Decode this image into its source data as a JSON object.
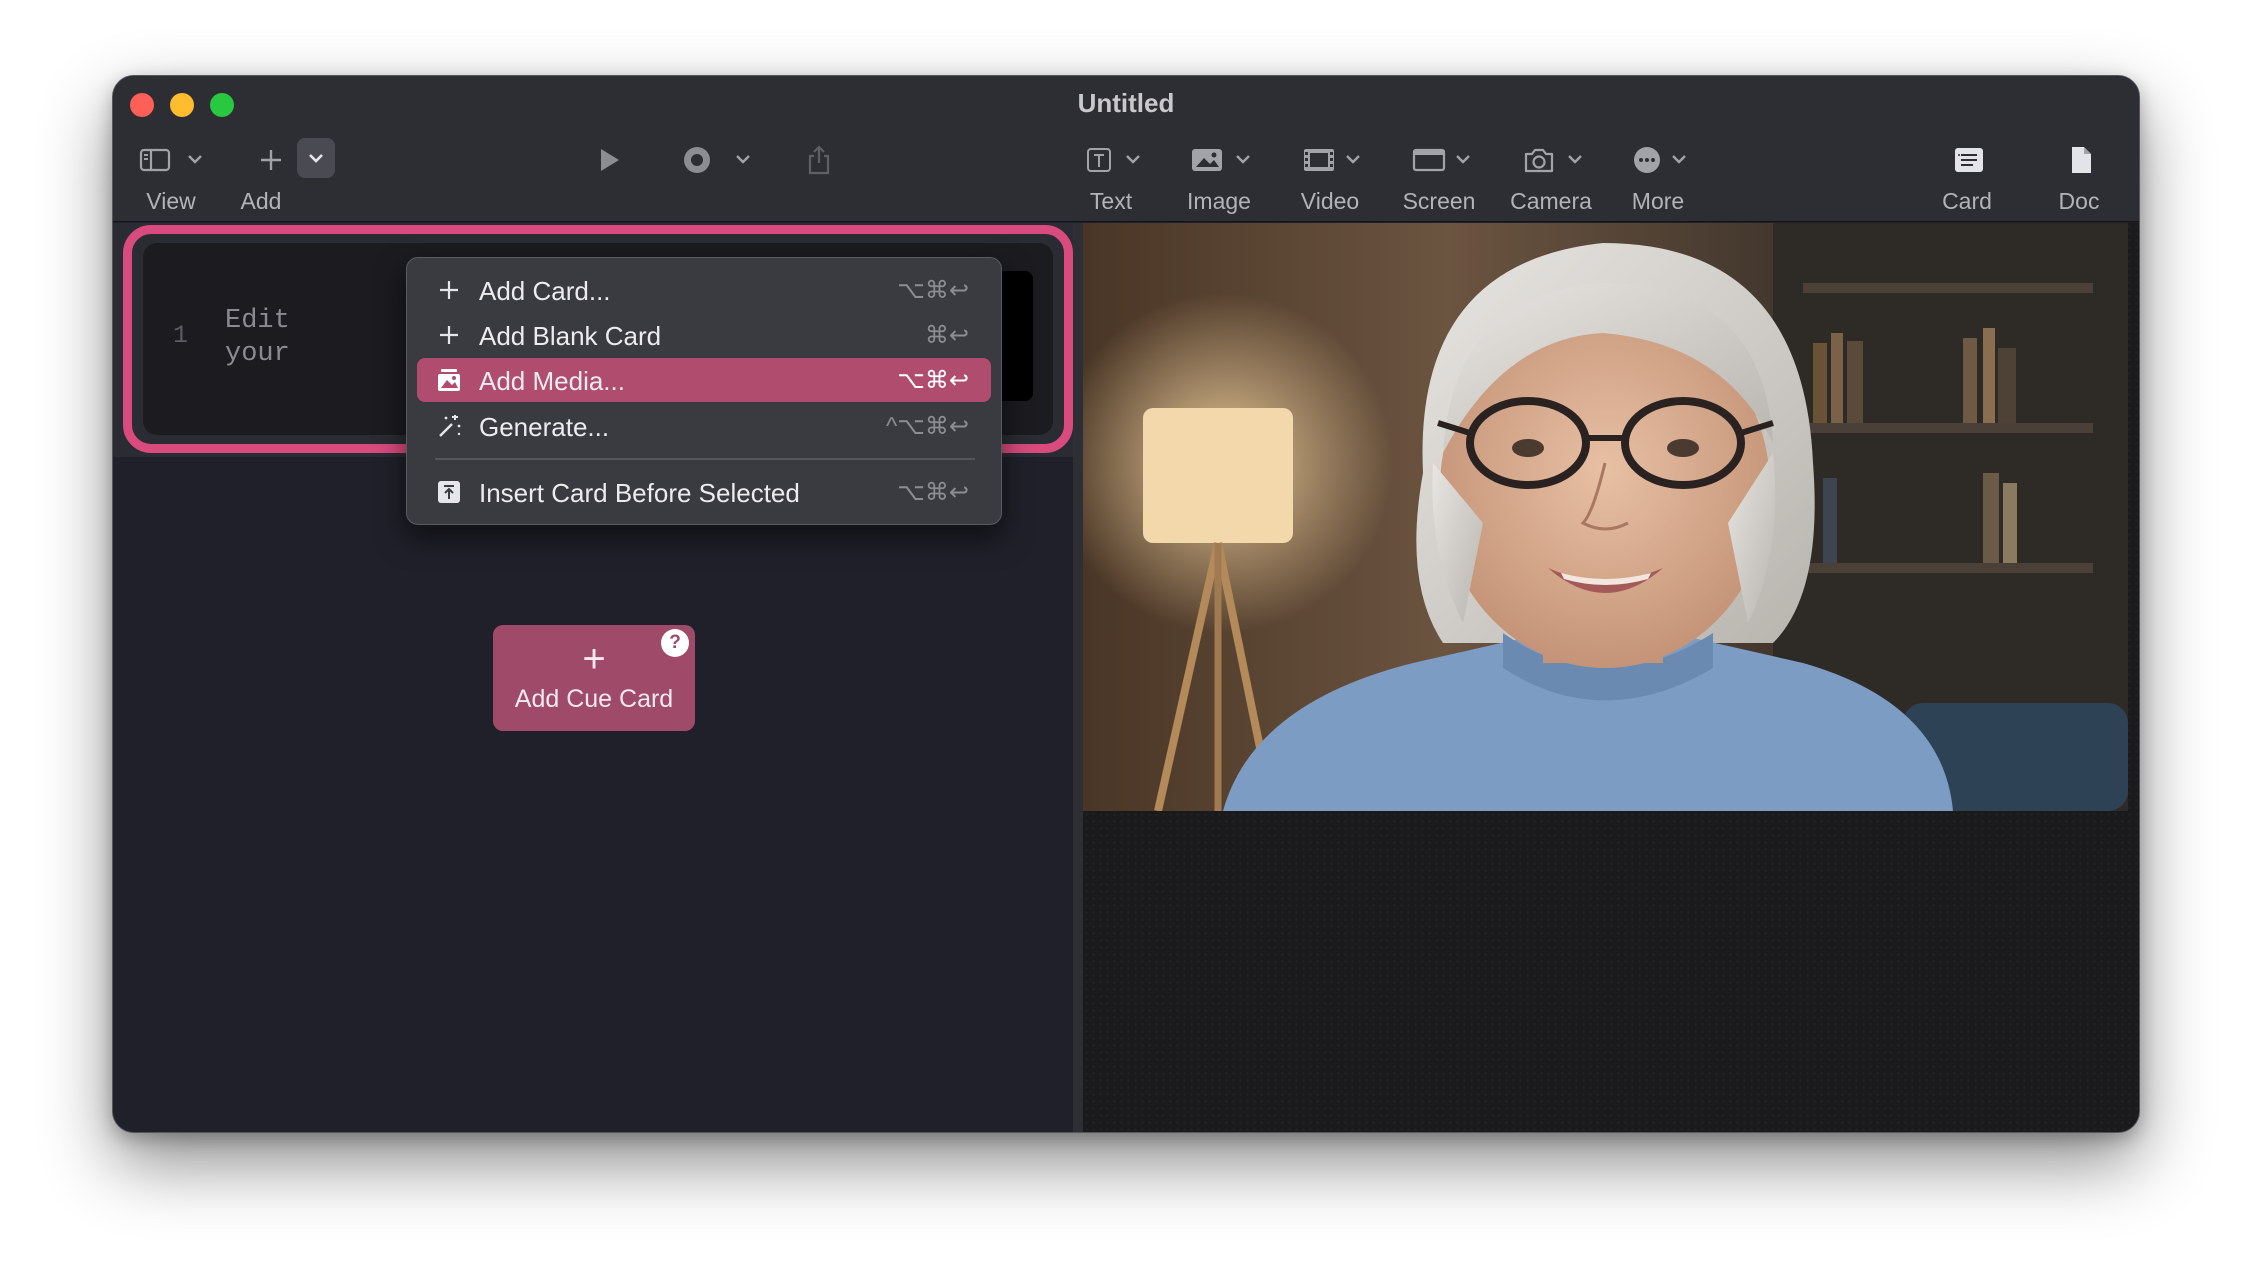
{
  "window": {
    "title": "Untitled"
  },
  "toolbar": {
    "view_label": "View",
    "add_label": "Add",
    "text_label": "Text",
    "image_label": "Image",
    "video_label": "Video",
    "screen_label": "Screen",
    "camera_label": "Camera",
    "more_label": "More",
    "card_label": "Card",
    "doc_label": "Doc"
  },
  "card": {
    "number": "1",
    "text": "Edit\nyour"
  },
  "add_cue_card": {
    "plus": "+",
    "label": "Add Cue Card",
    "help": "?"
  },
  "menu": {
    "items": [
      {
        "label": "Add Card...",
        "shortcut": "⌥⌘↩",
        "icon": "plus-icon",
        "selected": false
      },
      {
        "label": "Add Blank Card",
        "shortcut": "⌘↩",
        "icon": "plus-icon",
        "selected": false
      },
      {
        "label": "Add Media...",
        "shortcut": "⌥⌘↩",
        "icon": "photo-stack-icon",
        "selected": true
      },
      {
        "label": "Generate...",
        "shortcut": "^⌥⌘↩",
        "icon": "magic-wand-icon",
        "selected": false
      },
      {
        "label": "Insert Card Before Selected",
        "shortcut": "⌥⌘↩",
        "icon": "insert-before-icon",
        "selected": false
      }
    ]
  },
  "colors": {
    "accent": "#d94a7e",
    "menu_selected": "#b04d6e",
    "cue_button": "#9e4a68"
  }
}
